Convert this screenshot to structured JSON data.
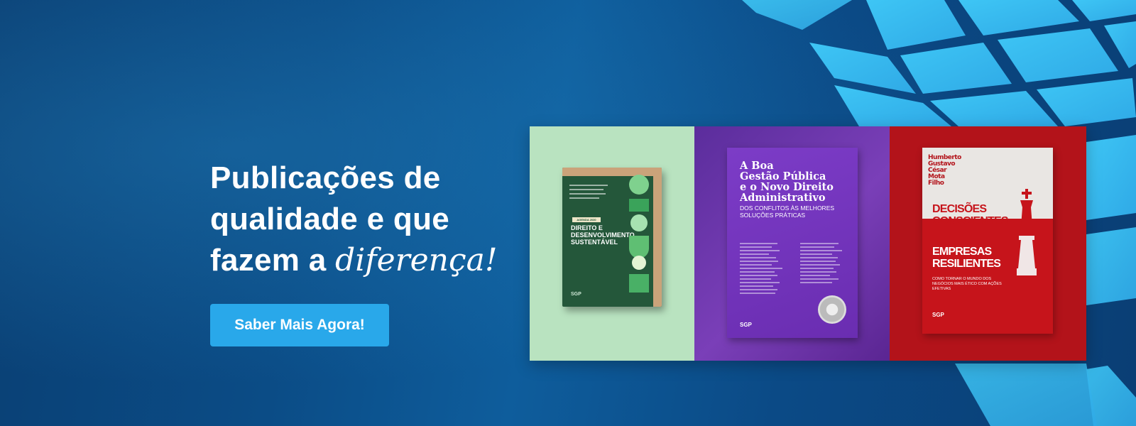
{
  "headline": {
    "line1": "Publicações de",
    "line2": "qualidade e que",
    "line3_prefix": "fazem a ",
    "line3_emphasis": "diferença!"
  },
  "cta": {
    "label": "Saber Mais Agora!"
  },
  "colors": {
    "background": "#0b4a86",
    "accent_button": "#29a8ea",
    "tile_blue": "#38bdf0",
    "green_panel": "#b9e3c0",
    "purple_panel": "#6a2db1",
    "red_panel": "#b3131a"
  },
  "books": {
    "green": {
      "tag": "AGENDA 2030",
      "title_line1": "DIREITO E",
      "title_line2": "DESENVOLVIMENTO",
      "title_line3": "SUSTENTÁVEL",
      "publisher_logo": "SGP"
    },
    "purple": {
      "title_line1": "A Boa",
      "title_line2": "Gestão Pública",
      "title_line3": "e o Novo Direito",
      "title_line4": "Administrativo",
      "subtitle": "DOS CONFLITOS ÀS MELHORES SOLUÇÕES PRÁTICAS",
      "publisher_logo": "SGP"
    },
    "red": {
      "authors_line1": "Humberto",
      "authors_line2": "Gustavo",
      "authors_line3": "César",
      "authors_line4": "Mota",
      "authors_line5": "Filho",
      "title_part1_line1": "DECISÕES",
      "title_part1_line2": "CONSCIENTES",
      "title_part2_line1": "EMPRESAS",
      "title_part2_line2": "RESILIENTES",
      "subtitle": "COMO TORNAR O MUNDO DOS NEGÓCIOS MAIS ÉTICO COM AÇÕES EFETIVAS",
      "publisher_logo": "SGP"
    }
  }
}
